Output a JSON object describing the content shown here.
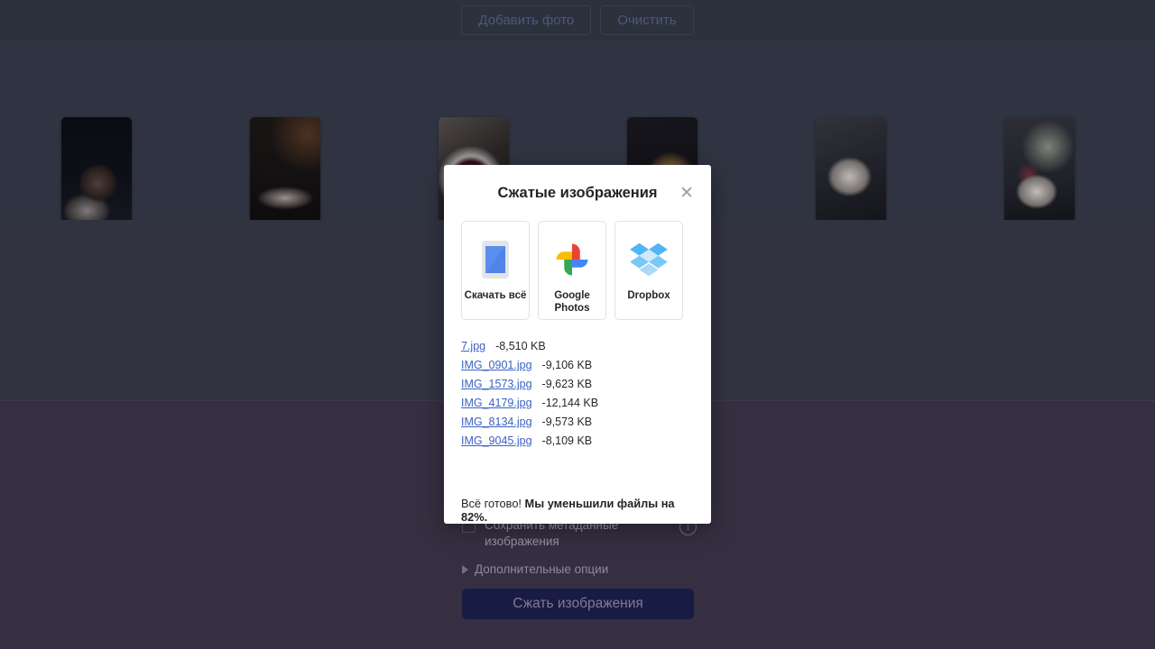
{
  "toolbar": {
    "add_photo_label": "Добавить фото",
    "clear_label": "Очистить"
  },
  "thumbnails": [
    {
      "name": "thumbnail-1"
    },
    {
      "name": "thumbnail-2"
    },
    {
      "name": "thumbnail-3"
    },
    {
      "name": "thumbnail-4"
    },
    {
      "name": "thumbnail-5"
    },
    {
      "name": "thumbnail-6"
    }
  ],
  "settings": {
    "keep_metadata_label": "Сохранить метаданные изображения",
    "info_glyph": "i",
    "advanced_options_label": "Дополнительные опции",
    "compress_button_label": "Сжать изображения"
  },
  "modal": {
    "title": "Сжатые изображения",
    "close_glyph": "✕",
    "destinations": [
      {
        "label": "Скачать\nвсё",
        "icon": "device-download-icon"
      },
      {
        "label": "Google\nPhotos",
        "icon": "google-photos-icon"
      },
      {
        "label": "Dropbox",
        "icon": "dropbox-icon"
      }
    ],
    "files": [
      {
        "name": "7.jpg",
        "saved": "-8,510 KB"
      },
      {
        "name": "IMG_0901.jpg",
        "saved": "-9,106 KB"
      },
      {
        "name": "IMG_1573.jpg",
        "saved": "-9,623 KB"
      },
      {
        "name": "IMG_4179.jpg",
        "saved": "-12,144 KB"
      },
      {
        "name": "IMG_8134.jpg",
        "saved": "-9,573 KB"
      },
      {
        "name": "IMG_9045.jpg",
        "saved": "-8,109 KB"
      }
    ],
    "summary_prefix": "Всё готово! ",
    "summary_strong": "Мы уменьшили файлы на 82%."
  },
  "colors": {
    "page_bg": "#343a46",
    "settings_bg": "#3e384a",
    "modal_bg": "#ffffff",
    "link": "#3a62c4",
    "primary_button": "#1a1f4d"
  }
}
